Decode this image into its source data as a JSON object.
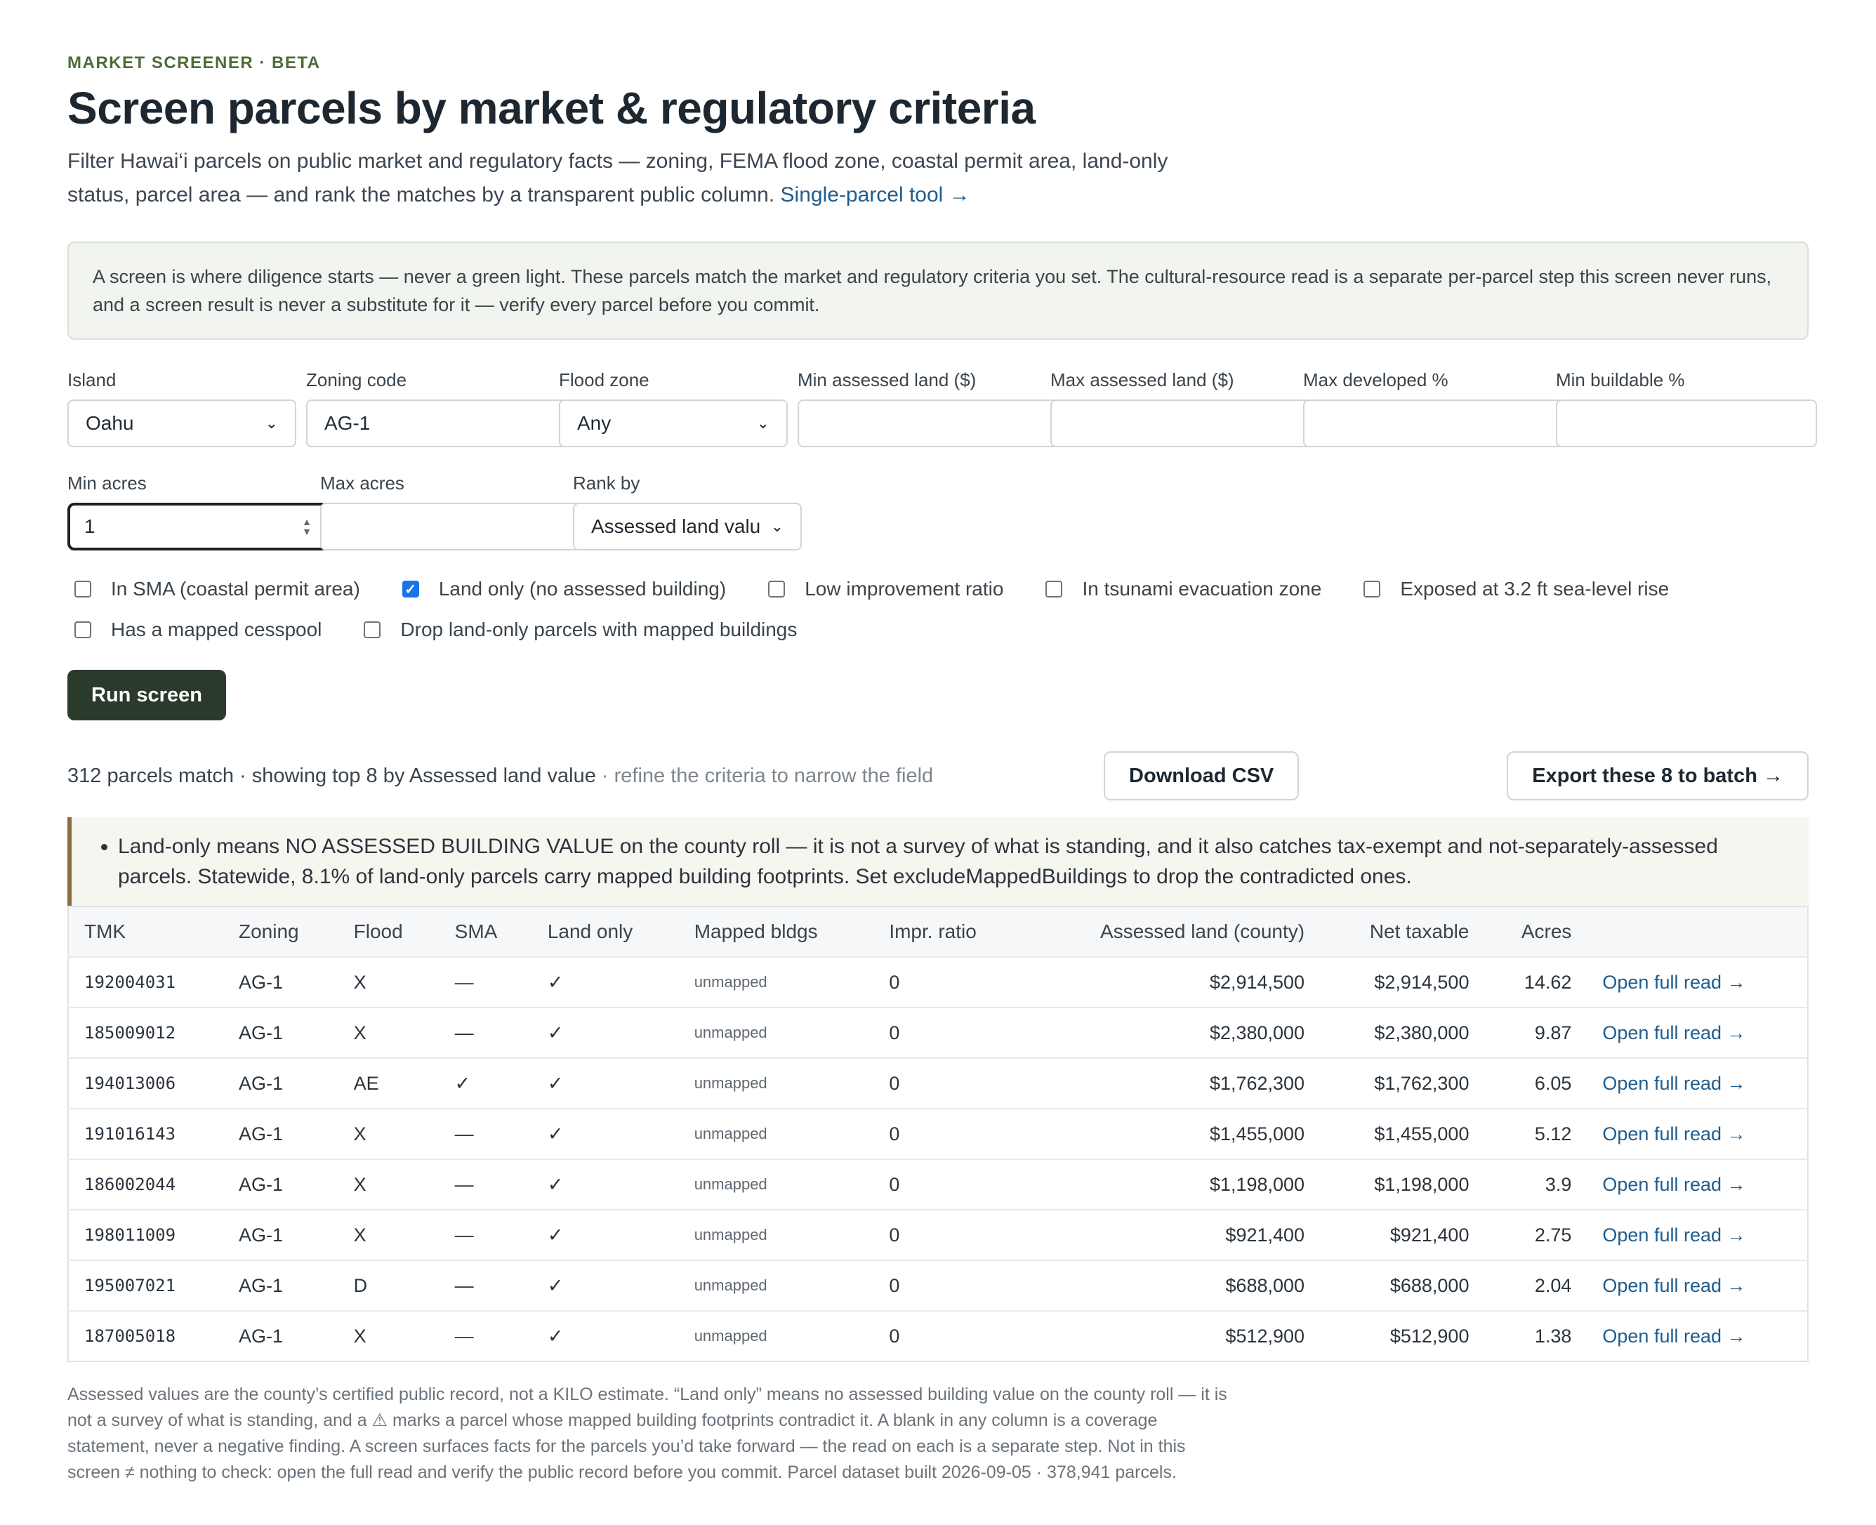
{
  "header": {
    "eyebrow": "MARKET SCREENER · BETA",
    "title": "Screen parcels by market & regulatory criteria",
    "lede": "Filter Hawai‘i parcels on public market and regulatory facts — zoning, FEMA flood zone, coastal permit area, land-only status, parcel area — and rank the matches by a transparent public column.",
    "single_parcel_link": "Single-parcel tool →"
  },
  "notice": "A screen is where diligence starts — never a green light. These parcels match the market and regulatory criteria you set. The cultural-resource read is a separate per-parcel step this screen never runs, and a screen result is never a substitute for it — verify every parcel before you commit.",
  "filters": {
    "island": {
      "label": "Island",
      "value": "Oahu"
    },
    "zoning": {
      "label": "Zoning code",
      "value": "AG-1"
    },
    "flood": {
      "label": "Flood zone",
      "value": "Any"
    },
    "min_land": {
      "label": "Min assessed land ($)",
      "value": ""
    },
    "max_land": {
      "label": "Max assessed land ($)",
      "value": ""
    },
    "max_dev": {
      "label": "Max developed %",
      "value": ""
    },
    "min_build": {
      "label": "Min buildable %",
      "value": ""
    },
    "min_acres": {
      "label": "Min acres",
      "value": "1"
    },
    "max_acres": {
      "label": "Max acres",
      "value": ""
    },
    "rank_by": {
      "label": "Rank by",
      "value": "Assessed land valu"
    }
  },
  "checkboxes": {
    "sma": {
      "label": "In SMA (coastal permit area)",
      "checked": false
    },
    "land_only": {
      "label": "Land only (no assessed building)",
      "checked": true
    },
    "low_impr": {
      "label": "Low improvement ratio",
      "checked": false
    },
    "tsunami": {
      "label": "In tsunami evacuation zone",
      "checked": false
    },
    "slr": {
      "label": "Exposed at 3.2 ft sea-level rise",
      "checked": false
    },
    "cesspool": {
      "label": "Has a mapped cesspool",
      "checked": false
    },
    "drop_mapped": {
      "label": "Drop land-only parcels with mapped buildings",
      "checked": false
    }
  },
  "run_label": "Run screen",
  "results": {
    "summary": "312 parcels match · showing top 8 by Assessed land value",
    "hint": "· refine the criteria to narrow the field",
    "download_label": "Download CSV",
    "export_label": "Export these 8 to batch →"
  },
  "warning": "Land-only means NO ASSESSED BUILDING VALUE on the county roll — it is not a survey of what is standing, and it also catches tax-exempt and not-separately-assessed parcels. Statewide, 8.1% of land-only parcels carry mapped building footprints. Set excludeMappedBuildings to drop the contradicted ones.",
  "table": {
    "headers": [
      "TMK",
      "Zoning",
      "Flood",
      "SMA",
      "Land only",
      "Mapped bldgs",
      "Impr. ratio",
      "Assessed land (county)",
      "Net taxable",
      "Acres",
      ""
    ],
    "rows": [
      [
        "192004031",
        "AG-1",
        "X",
        "—",
        "✓",
        "unmapped",
        "0",
        "$2,914,500",
        "$2,914,500",
        "14.62",
        "Open full read →"
      ],
      [
        "185009012",
        "AG-1",
        "X",
        "—",
        "✓",
        "unmapped",
        "0",
        "$2,380,000",
        "$2,380,000",
        "9.87",
        "Open full read →"
      ],
      [
        "194013006",
        "AG-1",
        "AE",
        "✓",
        "✓",
        "unmapped",
        "0",
        "$1,762,300",
        "$1,762,300",
        "6.05",
        "Open full read →"
      ],
      [
        "191016143",
        "AG-1",
        "X",
        "—",
        "✓",
        "unmapped",
        "0",
        "$1,455,000",
        "$1,455,000",
        "5.12",
        "Open full read →"
      ],
      [
        "186002044",
        "AG-1",
        "X",
        "—",
        "✓",
        "unmapped",
        "0",
        "$1,198,000",
        "$1,198,000",
        "3.9",
        "Open full read →"
      ],
      [
        "198011009",
        "AG-1",
        "X",
        "—",
        "✓",
        "unmapped",
        "0",
        "$921,400",
        "$921,400",
        "2.75",
        "Open full read →"
      ],
      [
        "195007021",
        "AG-1",
        "D",
        "—",
        "✓",
        "unmapped",
        "0",
        "$688,000",
        "$688,000",
        "2.04",
        "Open full read →"
      ],
      [
        "187005018",
        "AG-1",
        "X",
        "—",
        "✓",
        "unmapped",
        "0",
        "$512,900",
        "$512,900",
        "1.38",
        "Open full read →"
      ]
    ]
  },
  "footnote": "Assessed values are the county’s certified public record, not a KILO estimate. “Land only” means no assessed building value on the county roll — it is not a survey of what is standing, and a ⚠ marks a parcel whose mapped building footprints contradict it. A blank in any column is a coverage statement, never a negative finding. A screen surfaces facts for the parcels you’d take forward — the read on each is a separate step. Not in this screen ≠ nothing to check: open the full read and verify the public record before you commit. Parcel dataset built 2026-09-05 · 378,941 parcels.",
  "colors": {
    "accent": "#2a3a2b",
    "link": "#1f5d8e",
    "eyebrow": "#4e6b3a",
    "warn_border": "#8b6e3c",
    "checkbox": "#1a73e8"
  }
}
